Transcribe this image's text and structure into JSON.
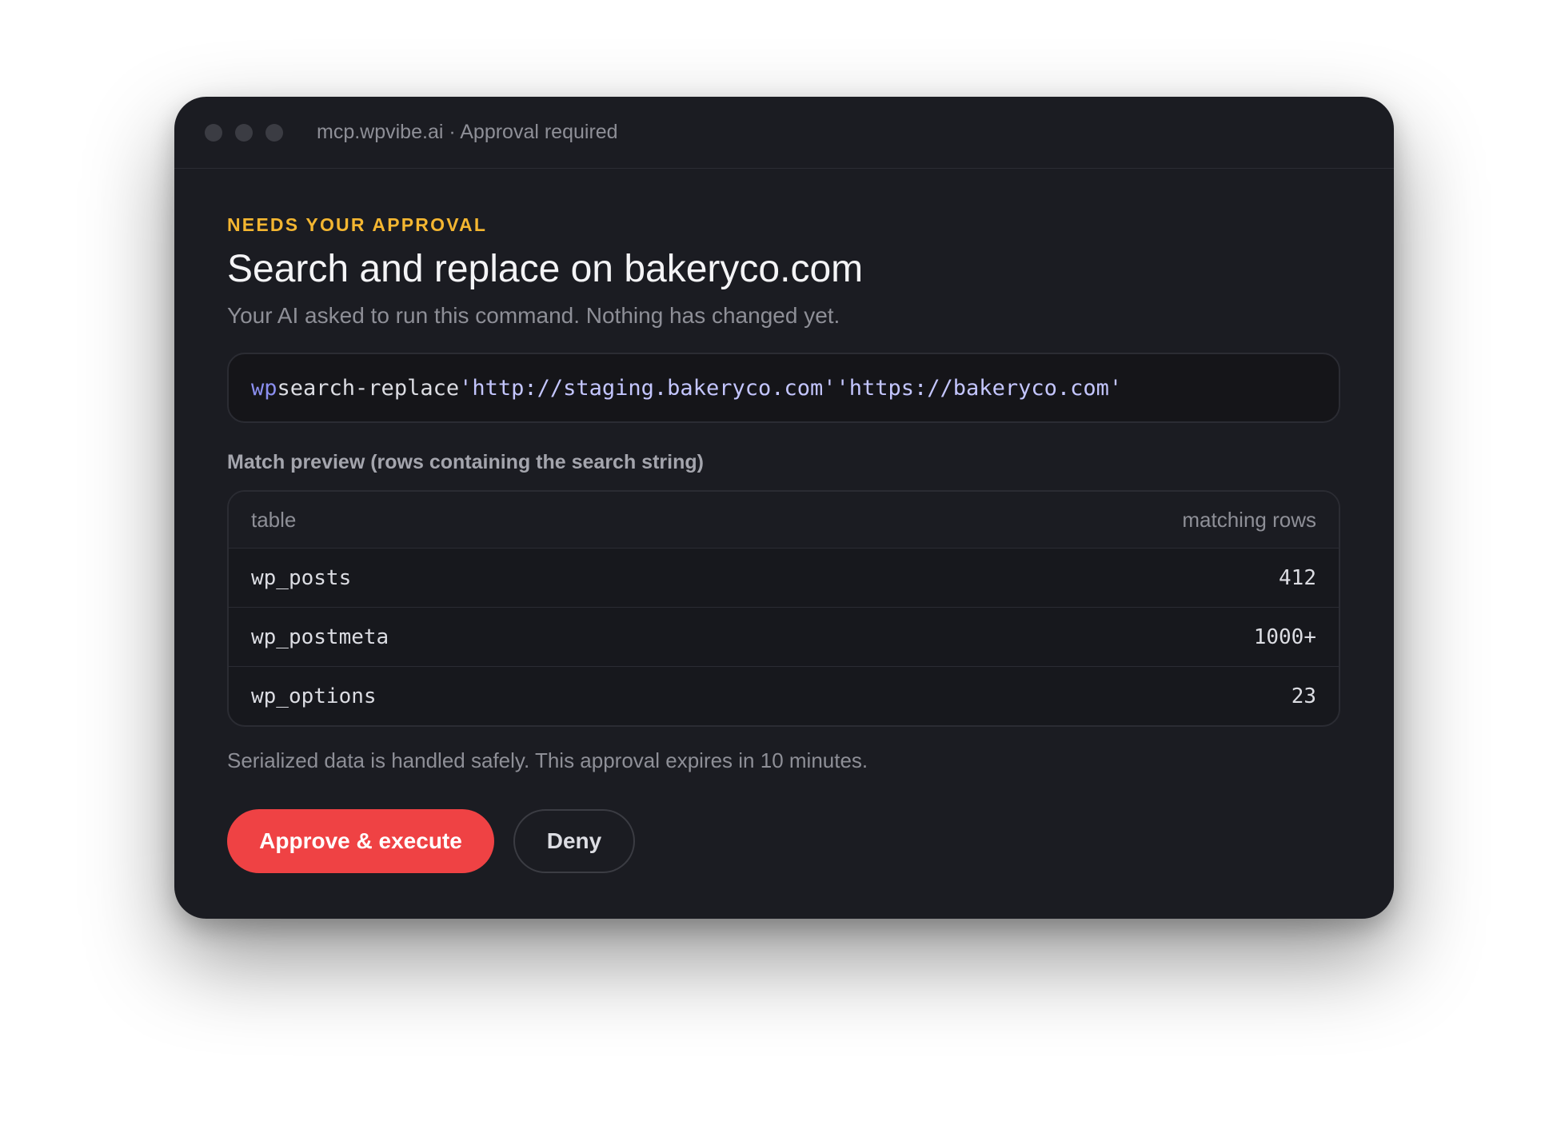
{
  "window": {
    "title": "mcp.wpvibe.ai · Approval required"
  },
  "approval": {
    "eyebrow": "NEEDS YOUR APPROVAL",
    "heading": "Search and replace on bakeryco.com",
    "subtitle": "Your AI asked to run this command. Nothing has changed yet."
  },
  "command": {
    "program": "wp",
    "subcommand": "search-replace",
    "search": "'http://staging.bakeryco.com'",
    "replace": "'https://bakeryco.com'"
  },
  "preview": {
    "label": "Match preview (rows containing the search string)",
    "columns": [
      "table",
      "matching rows"
    ],
    "rows": [
      {
        "table": "wp_posts",
        "count": "412"
      },
      {
        "table": "wp_postmeta",
        "count": "1000+"
      },
      {
        "table": "wp_options",
        "count": "23"
      }
    ]
  },
  "footnote": "Serialized data is handled safely. This approval expires in 10 minutes.",
  "actions": {
    "approve_label": "Approve & execute",
    "deny_label": "Deny"
  },
  "colors": {
    "accent_warning": "#f4b631",
    "approve": "#ef4244",
    "background": "#1b1c22"
  }
}
